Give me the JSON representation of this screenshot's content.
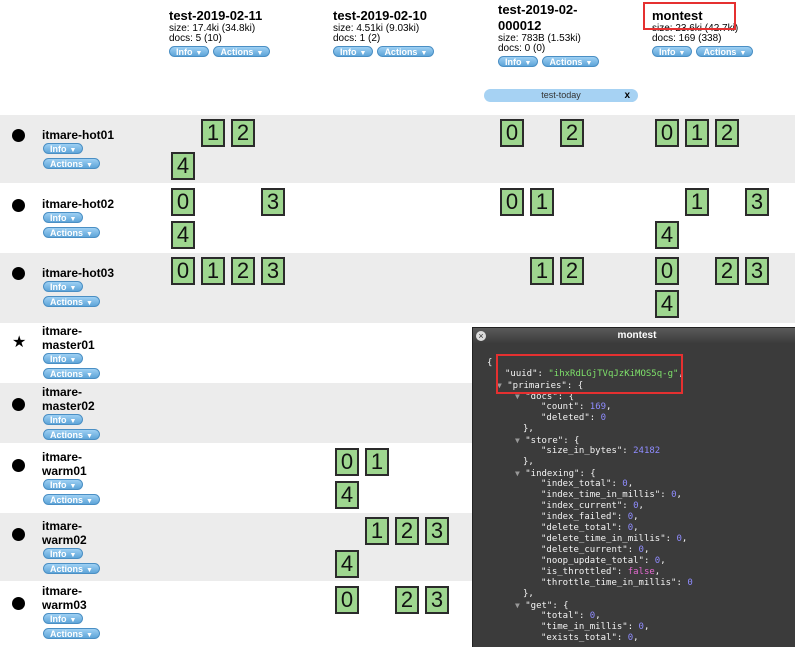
{
  "buttons": {
    "info": "Info",
    "actions": "Actions"
  },
  "indices": [
    {
      "name": "test-2019-02-11",
      "size": "size: 17.4ki (34.8ki)",
      "docs": "docs: 5 (10)"
    },
    {
      "name": "test-2019-02-10",
      "size": "size: 4.51ki (9.03ki)",
      "docs": "docs: 1 (2)"
    },
    {
      "name": "test-2019-02-000012",
      "name_line1": "test-2019-02-",
      "name_line2": "000012",
      "size": "size: 783B (1.53ki)",
      "docs": "docs: 0 (0)"
    },
    {
      "name": "montest",
      "size": "size: 23.6ki (42.7ki)",
      "docs": "docs: 169 (338)"
    }
  ],
  "alias": {
    "label": "test-today",
    "remove": "x"
  },
  "nodes": [
    {
      "name": "itmare-hot01",
      "icon": "dot"
    },
    {
      "name": "itmare-hot02",
      "icon": "dot"
    },
    {
      "name": "itmare-hot03",
      "icon": "dot"
    },
    {
      "name": "itmare-master01",
      "name_line1": "itmare-",
      "name_line2": "master01",
      "icon": "star"
    },
    {
      "name": "itmare-master02",
      "name_line1": "itmare-",
      "name_line2": "master02",
      "icon": "dot"
    },
    {
      "name": "itmare-warm01",
      "name_line1": "itmare-",
      "name_line2": "warm01",
      "icon": "dot"
    },
    {
      "name": "itmare-warm02",
      "name_line1": "itmare-",
      "name_line2": "warm02",
      "icon": "dot"
    },
    {
      "name": "itmare-warm03",
      "name_line1": "itmare-",
      "name_line2": "warm03",
      "icon": "dot"
    }
  ],
  "shards": [
    {
      "node": "itmare-hot01",
      "index": "test-2019-02-11",
      "number": "1"
    },
    {
      "node": "itmare-hot01",
      "index": "test-2019-02-11",
      "number": "2"
    },
    {
      "node": "itmare-hot01",
      "index": "test-2019-02-11",
      "number": "4"
    },
    {
      "node": "itmare-hot01",
      "index": "test-2019-02-000012",
      "number": "0"
    },
    {
      "node": "itmare-hot01",
      "index": "test-2019-02-000012",
      "number": "2"
    },
    {
      "node": "itmare-hot01",
      "index": "montest",
      "number": "0"
    },
    {
      "node": "itmare-hot01",
      "index": "montest",
      "number": "1"
    },
    {
      "node": "itmare-hot01",
      "index": "montest",
      "number": "2"
    },
    {
      "node": "itmare-hot02",
      "index": "test-2019-02-11",
      "number": "0"
    },
    {
      "node": "itmare-hot02",
      "index": "test-2019-02-11",
      "number": "3"
    },
    {
      "node": "itmare-hot02",
      "index": "test-2019-02-11",
      "number": "4"
    },
    {
      "node": "itmare-hot02",
      "index": "test-2019-02-000012",
      "number": "0"
    },
    {
      "node": "itmare-hot02",
      "index": "test-2019-02-000012",
      "number": "1"
    },
    {
      "node": "itmare-hot02",
      "index": "montest",
      "number": "1"
    },
    {
      "node": "itmare-hot02",
      "index": "montest",
      "number": "3"
    },
    {
      "node": "itmare-hot02",
      "index": "montest",
      "number": "4"
    },
    {
      "node": "itmare-hot03",
      "index": "test-2019-02-11",
      "number": "0"
    },
    {
      "node": "itmare-hot03",
      "index": "test-2019-02-11",
      "number": "1"
    },
    {
      "node": "itmare-hot03",
      "index": "test-2019-02-11",
      "number": "2"
    },
    {
      "node": "itmare-hot03",
      "index": "test-2019-02-11",
      "number": "3"
    },
    {
      "node": "itmare-hot03",
      "index": "test-2019-02-000012",
      "number": "1"
    },
    {
      "node": "itmare-hot03",
      "index": "test-2019-02-000012",
      "number": "2"
    },
    {
      "node": "itmare-hot03",
      "index": "montest",
      "number": "0"
    },
    {
      "node": "itmare-hot03",
      "index": "montest",
      "number": "2"
    },
    {
      "node": "itmare-hot03",
      "index": "montest",
      "number": "3"
    },
    {
      "node": "itmare-hot03",
      "index": "montest",
      "number": "4"
    },
    {
      "node": "itmare-warm01",
      "index": "test-2019-02-10",
      "number": "0"
    },
    {
      "node": "itmare-warm01",
      "index": "test-2019-02-10",
      "number": "1"
    },
    {
      "node": "itmare-warm01",
      "index": "test-2019-02-10",
      "number": "4"
    },
    {
      "node": "itmare-warm02",
      "index": "test-2019-02-10",
      "number": "1"
    },
    {
      "node": "itmare-warm02",
      "index": "test-2019-02-10",
      "number": "2"
    },
    {
      "node": "itmare-warm02",
      "index": "test-2019-02-10",
      "number": "3"
    },
    {
      "node": "itmare-warm02",
      "index": "test-2019-02-10",
      "number": "4"
    },
    {
      "node": "itmare-warm03",
      "index": "test-2019-02-10",
      "number": "0"
    },
    {
      "node": "itmare-warm03",
      "index": "test-2019-02-10",
      "number": "2"
    },
    {
      "node": "itmare-warm03",
      "index": "test-2019-02-10",
      "number": "3"
    }
  ],
  "modal": {
    "title": "montest",
    "close": "×",
    "json_lines": [
      {
        "t": "{"
      },
      {
        "k": "\"uuid\"",
        "s": "\"ihxRdLGjTVqJzKiMOS5q-g\"",
        "tail": ","
      },
      {
        "tri": "▼",
        "k": "\"primaries\"",
        "tail": ": {"
      },
      {
        "tri": "▼",
        "k": "\"docs\"",
        "tail": ": {"
      },
      {
        "k": "\"count\"",
        "n": "169",
        "tail": ","
      },
      {
        "k": "\"deleted\"",
        "n": "0"
      },
      {
        "t": "},"
      },
      {
        "tri": "▼",
        "k": "\"store\"",
        "tail": ": {"
      },
      {
        "k": "\"size_in_bytes\"",
        "n": "24182"
      },
      {
        "t": "},"
      },
      {
        "tri": "▼",
        "k": "\"indexing\"",
        "tail": ": {"
      },
      {
        "k": "\"index_total\"",
        "n": "0",
        "tail": ","
      },
      {
        "k": "\"index_time_in_millis\"",
        "n": "0",
        "tail": ","
      },
      {
        "k": "\"index_current\"",
        "n": "0",
        "tail": ","
      },
      {
        "k": "\"index_failed\"",
        "n": "0",
        "tail": ","
      },
      {
        "k": "\"delete_total\"",
        "n": "0",
        "tail": ","
      },
      {
        "k": "\"delete_time_in_millis\"",
        "n": "0",
        "tail": ","
      },
      {
        "k": "\"delete_current\"",
        "n": "0",
        "tail": ","
      },
      {
        "k": "\"noop_update_total\"",
        "n": "0",
        "tail": ","
      },
      {
        "k": "\"is_throttled\"",
        "b": "false",
        "tail": ","
      },
      {
        "k": "\"throttle_time_in_millis\"",
        "n": "0"
      },
      {
        "t": "},"
      },
      {
        "tri": "▼",
        "k": "\"get\"",
        "tail": ": {"
      },
      {
        "k": "\"total\"",
        "n": "0",
        "tail": ","
      },
      {
        "k": "\"time_in_millis\"",
        "n": "0",
        "tail": ","
      },
      {
        "k": "\"exists_total\"",
        "n": "0",
        "tail": ","
      }
    ]
  },
  "colors": {
    "shard_green": "#9ed68f",
    "row_shade": "#ececec",
    "highlight_red": "#e53030",
    "modal_bg": "#3b3b3b"
  }
}
